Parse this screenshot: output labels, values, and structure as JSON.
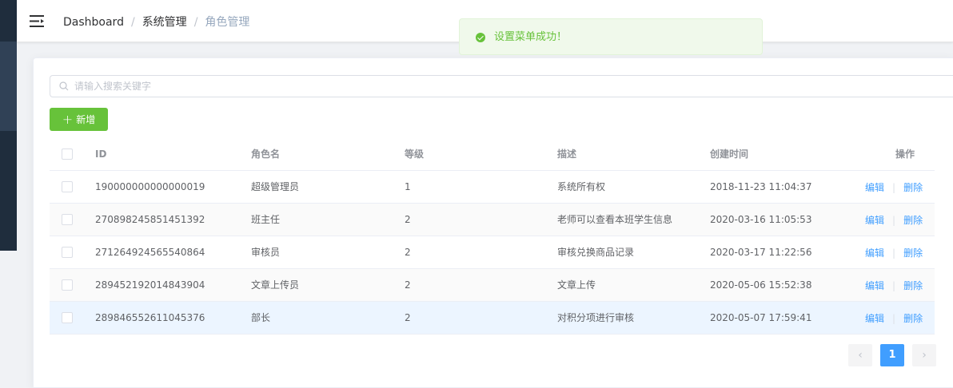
{
  "breadcrumb": {
    "items": [
      "Dashboard",
      "系统管理",
      "角色管理"
    ],
    "separator": "/"
  },
  "toast": {
    "message": "设置菜单成功！",
    "type": "success"
  },
  "search": {
    "placeholder": "请输入搜索关键字",
    "value": ""
  },
  "toolbar": {
    "add_label": "新增",
    "add_icon": "+"
  },
  "table": {
    "headers": {
      "id": "ID",
      "name": "角色名",
      "level": "等级",
      "desc": "描述",
      "created": "创建时间",
      "actions": "操作"
    },
    "rows": [
      {
        "id": "190000000000000019",
        "name": "超级管理员",
        "level": "1",
        "desc": "系统所有权",
        "created": "2018-11-23 11:04:37"
      },
      {
        "id": "270898245851451392",
        "name": "班主任",
        "level": "2",
        "desc": "老师可以查看本班学生信息",
        "created": "2020-03-16 11:05:53"
      },
      {
        "id": "271264924565540864",
        "name": "审核员",
        "level": "2",
        "desc": "审核兑换商品记录",
        "created": "2020-03-17 11:22:56"
      },
      {
        "id": "289452192014843904",
        "name": "文章上传员",
        "level": "2",
        "desc": "文章上传",
        "created": "2020-05-06 15:52:38"
      },
      {
        "id": "289846552611045376",
        "name": "部长",
        "level": "2",
        "desc": "对积分项进行审核",
        "created": "2020-05-07 17:59:41"
      }
    ],
    "action_edit": "编辑",
    "action_delete": "删除",
    "action_sep": "|"
  },
  "pagination": {
    "current": "1",
    "prev_icon": "‹",
    "next_icon": "›"
  },
  "colors": {
    "primary": "#409eff",
    "success": "#67c23a",
    "sidebar": "#304156"
  }
}
